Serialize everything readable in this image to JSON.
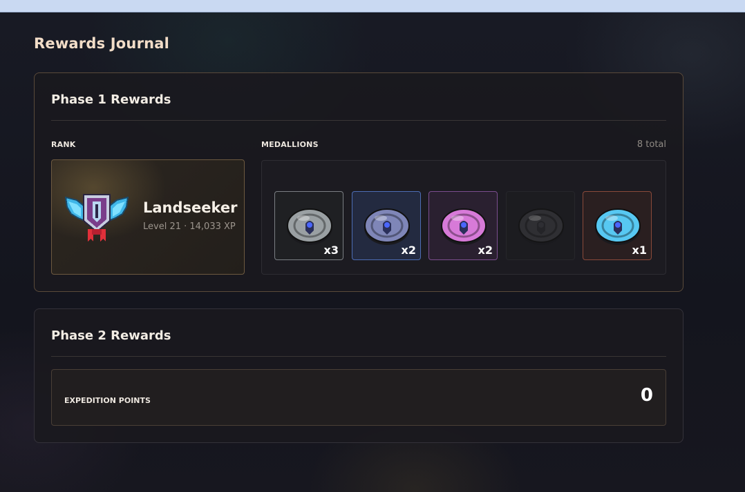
{
  "page": {
    "title": "Rewards Journal"
  },
  "phase1": {
    "title": "Phase 1 Rewards",
    "rank_label": "RANK",
    "rank": {
      "name": "Landseeker",
      "detail": "Level 21 · 14,033 XP",
      "icon": "winged-crest-icon"
    },
    "medallions_label": "MEDALLIONS",
    "medallions_total": "8 total",
    "medallions": [
      {
        "icon": "gray-medallion-icon",
        "count": "x3",
        "color": "#9aa0a3",
        "border": "#7b7f84",
        "bg": "#1f2023"
      },
      {
        "icon": "blue-medallion-icon",
        "count": "x2",
        "color": "#7f86b8",
        "border": "#4d6db5",
        "bg": "#232a40"
      },
      {
        "icon": "pink-medallion-icon",
        "count": "x2",
        "color": "#d77ad8",
        "border": "#7c4d8f",
        "bg": "#2a2030"
      },
      {
        "icon": "dark-medallion-icon",
        "count": "",
        "color": "#3c3c40",
        "border": "#26262b",
        "bg": "#1c1c20"
      },
      {
        "icon": "cyan-medallion-icon",
        "count": "x1",
        "color": "#57c8f2",
        "border": "#8a4a3a",
        "bg": "#2a1f20"
      }
    ]
  },
  "phase2": {
    "title": "Phase 2 Rewards",
    "expedition_label": "EXPEDITION POINTS",
    "expedition_value": "0"
  }
}
